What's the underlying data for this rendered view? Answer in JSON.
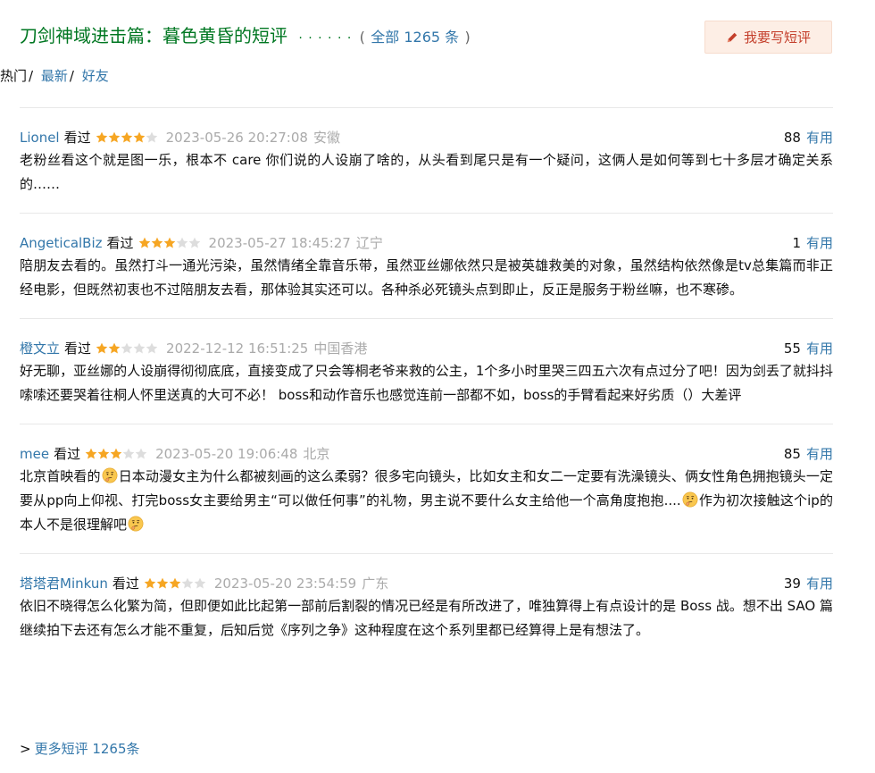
{
  "header": {
    "title": "刀剑神域进击篇：暮色黄昏的短评",
    "dots": "· · · · · ·",
    "paren_open": "(",
    "all_link": "全部 1265 条",
    "paren_close": ")",
    "write_button": "我要写短评"
  },
  "filters": {
    "items": [
      {
        "label": "热门",
        "active": true
      },
      {
        "label": "最新",
        "active": false
      },
      {
        "label": "好友",
        "active": false
      }
    ],
    "separator": "/"
  },
  "colors": {
    "title_green": "#007722",
    "link_blue": "#3377aa",
    "star_gold": "#f6a623",
    "star_grey": "#dddddd",
    "button_bg": "#fdeee5",
    "button_text": "#c43f2b",
    "meta_grey": "#aaaaaa"
  },
  "comments": [
    {
      "user": "Lionel",
      "status": "看过",
      "rating": 4,
      "time": "2023-05-26 20:27:08",
      "location": "安徽",
      "votes": "88",
      "useful_label": "有用",
      "content": "老粉丝看这个就是图一乐，根本不 care 你们说的人设崩了啥的，从头看到尾只是有一个疑问，这俩人是如何等到七十多层才确定关系的……"
    },
    {
      "user": "AngeticalBiz",
      "status": "看过",
      "rating": 3,
      "time": "2023-05-27 18:45:27",
      "location": "辽宁",
      "votes": "1",
      "useful_label": "有用",
      "content": "陪朋友去看的。虽然打斗一通光污染，虽然情绪全靠音乐带，虽然亚丝娜依然只是被英雄救美的对象，虽然结构依然像是tv总集篇而非正经电影，但既然初衷也不过陪朋友去看，那体验其实还可以。各种杀必死镜头点到即止，反正是服务于粉丝嘛，也不寒碜。"
    },
    {
      "user": "橙文立",
      "status": "看过",
      "rating": 2,
      "time": "2022-12-12 16:51:25",
      "location": "中国香港",
      "votes": "55",
      "useful_label": "有用",
      "content": "好无聊，亚丝娜的人设崩得彻彻底底，直接变成了只会等桐老爷来救的公主，1个多小时里哭三四五六次有点过分了吧！因为剑丢了就抖抖嗦嗦还要哭着往桐人怀里送真的大可不必！ boss和动作音乐也感觉连前一部都不如，boss的手臂看起来好劣质（）大差评"
    },
    {
      "user": "mee",
      "status": "看过",
      "rating": 3,
      "time": "2023-05-20 19:06:48",
      "location": "北京",
      "votes": "85",
      "useful_label": "有用",
      "content_parts": [
        {
          "text": "北京首映看的"
        },
        {
          "emoji": "thinking-face"
        },
        {
          "text": "日本动漫女主为什么都被刻画的这么柔弱？很多宅向镜头，比如女主和女二一定要有洗澡镜头、俩女性角色拥抱镜头一定要从pp向上仰视、打完boss女主要给男主“可以做任何事”的礼物，男主说不要什么女主给他一个高角度抱抱...."
        },
        {
          "emoji": "thinking-face"
        },
        {
          "text": "作为初次接触这个ip的本人不是很理解吧"
        },
        {
          "emoji": "thinking-face"
        }
      ]
    },
    {
      "user": "塔塔君Minkun",
      "status": "看过",
      "rating": 3,
      "time": "2023-05-20 23:54:59",
      "location": "广东",
      "votes": "39",
      "useful_label": "有用",
      "content": "依旧不晓得怎么化繁为简，但即便如此比起第一部前后割裂的情况已经是有所改进了，唯独算得上有点设计的是 Boss 战。想不出 SAO 篇继续拍下去还有怎么才能不重复，后知后觉《序列之争》这种程度在这个系列里都已经算得上是有想法了。"
    }
  ],
  "footer": {
    "arrow": ">",
    "more_link": "更多短评 1265条"
  }
}
